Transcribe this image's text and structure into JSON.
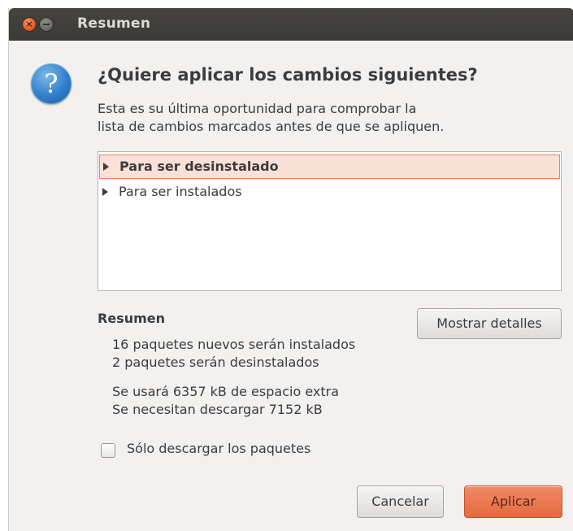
{
  "window": {
    "title": "Resumen",
    "controls": {
      "close_glyph": "×"
    }
  },
  "dialog": {
    "icon": "question-icon",
    "icon_glyph": "?",
    "heading": "¿Quiere aplicar los cambios siguientes?",
    "description_lines": [
      "Esta es su última oportunidad para comprobar la",
      "lista de cambios marcados antes de que se apliquen."
    ]
  },
  "changes_tree": {
    "rows": [
      {
        "label": "Para ser desinstalado",
        "selected": true
      },
      {
        "label": "Para ser instalados",
        "selected": false
      }
    ]
  },
  "summary": {
    "title": "Resumen",
    "details_button": "Mostrar detalles",
    "lines": [
      "16 paquetes nuevos serán instalados",
      "2 paquetes serán desinstalados",
      "Se usará 6357 kB de espacio extra",
      "Se necesitan descargar 7152 kB"
    ]
  },
  "options": {
    "download_only_label": "Sólo descargar los paquetes",
    "download_only_checked": false
  },
  "buttons": {
    "cancel": "Cancelar",
    "apply": "Aplicar"
  },
  "colors": {
    "titlebar": "#3c3b37",
    "accent": "#e56a40",
    "selection_bg": "#f9e1d7"
  }
}
